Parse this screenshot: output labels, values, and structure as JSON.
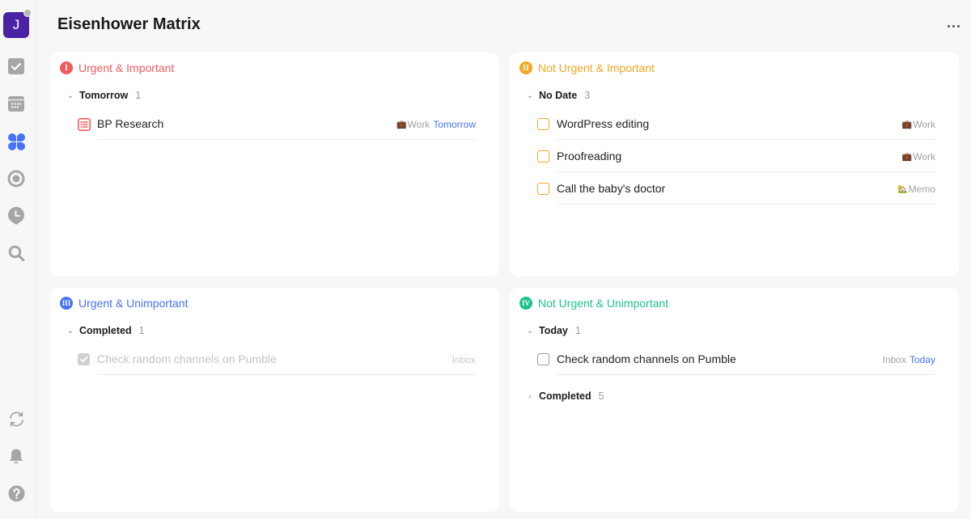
{
  "sidebar": {
    "avatar_initial": "J",
    "icons": [
      "task-check-icon",
      "calendar-icon",
      "matrix-icon",
      "focus-icon",
      "habit-clock-icon",
      "search-icon",
      "sync-icon",
      "bell-icon",
      "help-icon"
    ],
    "active_item": "matrix",
    "colors": {
      "avatar": "#4a23a5",
      "active": "#4772fa",
      "inactive": "#a6a6a6"
    }
  },
  "header": {
    "title": "Eisenhower Matrix",
    "more_icon": "more-horizontal-icon"
  },
  "quadrants": [
    {
      "numeral": "I",
      "title": "Urgent & Important",
      "color": "#f25c5c",
      "groups": [
        {
          "name": "Tomorrow",
          "count": "1",
          "expanded": true,
          "tasks": [
            {
              "title": "BP Research",
              "type": "note",
              "list": "Work",
              "list_icon": "briefcase-icon",
              "date": "Tomorrow",
              "completed": false
            }
          ]
        }
      ]
    },
    {
      "numeral": "II",
      "title": "Not Urgent & Important",
      "color": "#f5a623",
      "groups": [
        {
          "name": "No Date",
          "count": "3",
          "expanded": true,
          "tasks": [
            {
              "title": "WordPress editing",
              "list": "Work",
              "list_icon": "briefcase-icon",
              "completed": false
            },
            {
              "title": "Proofreading",
              "list": "Work",
              "list_icon": "briefcase-icon",
              "completed": false
            },
            {
              "title": "Call the baby's doctor",
              "list": "Memo",
              "list_icon": "house-icon",
              "completed": false
            }
          ]
        }
      ]
    },
    {
      "numeral": "III",
      "title": "Urgent & Unimportant",
      "color": "#4772fa",
      "groups": [
        {
          "name": "Completed",
          "count": "1",
          "expanded": true,
          "tasks": [
            {
              "title": "Check random channels on Pumble",
              "list": "Inbox",
              "completed": true
            }
          ]
        }
      ]
    },
    {
      "numeral": "IV",
      "title": "Not Urgent & Unimportant",
      "color": "#1ec38b",
      "groups": [
        {
          "name": "Today",
          "count": "1",
          "expanded": true,
          "tasks": [
            {
              "title": "Check random channels on Pumble",
              "list": "Inbox",
              "date": "Today",
              "completed": false
            }
          ]
        },
        {
          "name": "Completed",
          "count": "5",
          "expanded": false,
          "tasks": []
        }
      ]
    }
  ]
}
